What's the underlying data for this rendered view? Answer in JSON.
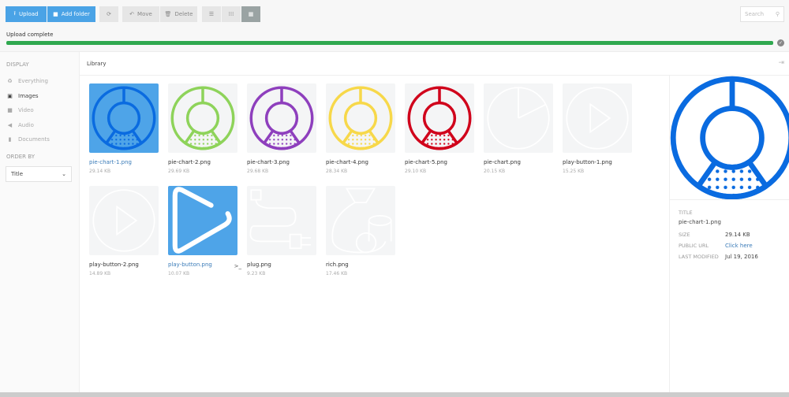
{
  "toolbar": {
    "upload": "Upload",
    "add_folder": "Add folder",
    "refresh_icon": "refresh-icon",
    "move": "Move",
    "delete": "Delete",
    "views": [
      "list-view",
      "grid-small-view",
      "grid-large-view"
    ],
    "active_view": "grid-large-view",
    "search_placeholder": "Search"
  },
  "upload": {
    "label": "Upload complete",
    "progress": 100,
    "color": "#2fa84f"
  },
  "sidebar": {
    "display_heading": "DISPLAY",
    "items": [
      {
        "label": "Everything",
        "icon": "recycle-icon"
      },
      {
        "label": "Images",
        "icon": "image-icon",
        "active": true
      },
      {
        "label": "Video",
        "icon": "video-icon"
      },
      {
        "label": "Audio",
        "icon": "audio-icon"
      },
      {
        "label": "Documents",
        "icon": "document-icon"
      }
    ],
    "order_heading": "ORDER BY",
    "order_value": "Title"
  },
  "library": {
    "title": "Library",
    "items": [
      {
        "name": "pie-chart-1.png",
        "size": "29.14 KB",
        "icon": "pie",
        "color": "#0a6be0",
        "selected": true
      },
      {
        "name": "pie-chart-2.png",
        "size": "29.69 KB",
        "icon": "pie",
        "color": "#8ed35a"
      },
      {
        "name": "pie-chart-3.png",
        "size": "29.68 KB",
        "icon": "pie",
        "color": "#8e3fbd"
      },
      {
        "name": "pie-chart-4.png",
        "size": "28.34 KB",
        "icon": "pie",
        "color": "#f7d84a"
      },
      {
        "name": "pie-chart-5.png",
        "size": "29.10 KB",
        "icon": "pie",
        "color": "#d0021b"
      },
      {
        "name": "pie-chart.png",
        "size": "20.15 KB",
        "icon": "piefaint",
        "color": "#ffffff"
      },
      {
        "name": "play-button-1.png",
        "size": "15.25 KB",
        "icon": "play",
        "color": "#ffffff"
      },
      {
        "name": "play-button-2.png",
        "size": "14.89 KB",
        "icon": "play",
        "color": "#ffffff"
      },
      {
        "name": "play-button.png",
        "size": "10.07 KB",
        "icon": "playsel",
        "color": "#ffffff",
        "selected": true,
        "more": ">_"
      },
      {
        "name": "plug.png",
        "size": "9.23 KB",
        "icon": "plug",
        "color": "#ffffff"
      },
      {
        "name": "rich.png",
        "size": "17.46 KB",
        "icon": "rich",
        "color": "#ffffff"
      }
    ]
  },
  "details": {
    "title_label": "TITLE",
    "title": "pie-chart-1.png",
    "size_label": "SIZE",
    "size": "29.14 KB",
    "url_label": "PUBLIC URL",
    "url": "Click here",
    "modified_label": "LAST MODIFIED",
    "modified": "Jul 19, 2016",
    "preview_color": "#0a6be0"
  }
}
